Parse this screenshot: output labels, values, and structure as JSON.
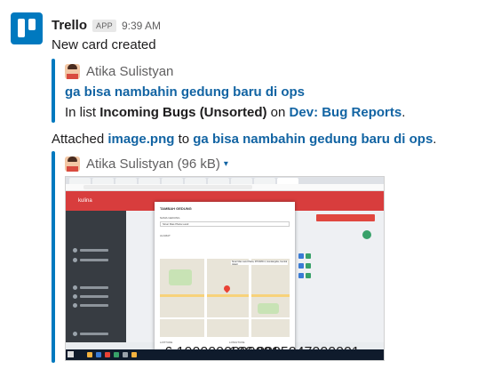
{
  "message": {
    "sender": "Trello",
    "badge": "APP",
    "time": "9:39 AM",
    "text": "New card created"
  },
  "card_attachment": {
    "author": "Atika Sulistyan",
    "card_title": "ga bisa nambahin gedung baru di ops",
    "list_prefix": "In list ",
    "list_name": "Incoming Bugs (Unsorted)",
    "list_on": " on ",
    "board_name": "Dev: Bug Reports",
    "list_suffix": "."
  },
  "file_line": {
    "prefix": "Attached ",
    "file_name": "image.png",
    "to": " to ",
    "card_title": "ga bisa nambahin gedung baru di ops",
    "suffix": "."
  },
  "image_attachment": {
    "author": "Atika Sulistyan",
    "size": "(96 kB)",
    "caret": "▾"
  },
  "preview": {
    "brand": "kulina",
    "modal_title": "TAMBAH GEDUNG",
    "name_label": "NAMA GEDUNG",
    "name_value": "Sinar Mas Plaza Land",
    "address_label": "ALAMAT",
    "map_tooltip": "Sinar Mas Land Plaza, RT.6/RW.4, Gondangdia, Central Jakart",
    "lat_label": "LATITUDE",
    "lat_value": "-6.1900000000001",
    "lng_label": "LONGITUDE",
    "lng_value": "106.8225247000001"
  },
  "colors": {
    "trello_blue": "#0079bf",
    "link": "#1264a3",
    "kulina_red": "#d83d3d"
  }
}
